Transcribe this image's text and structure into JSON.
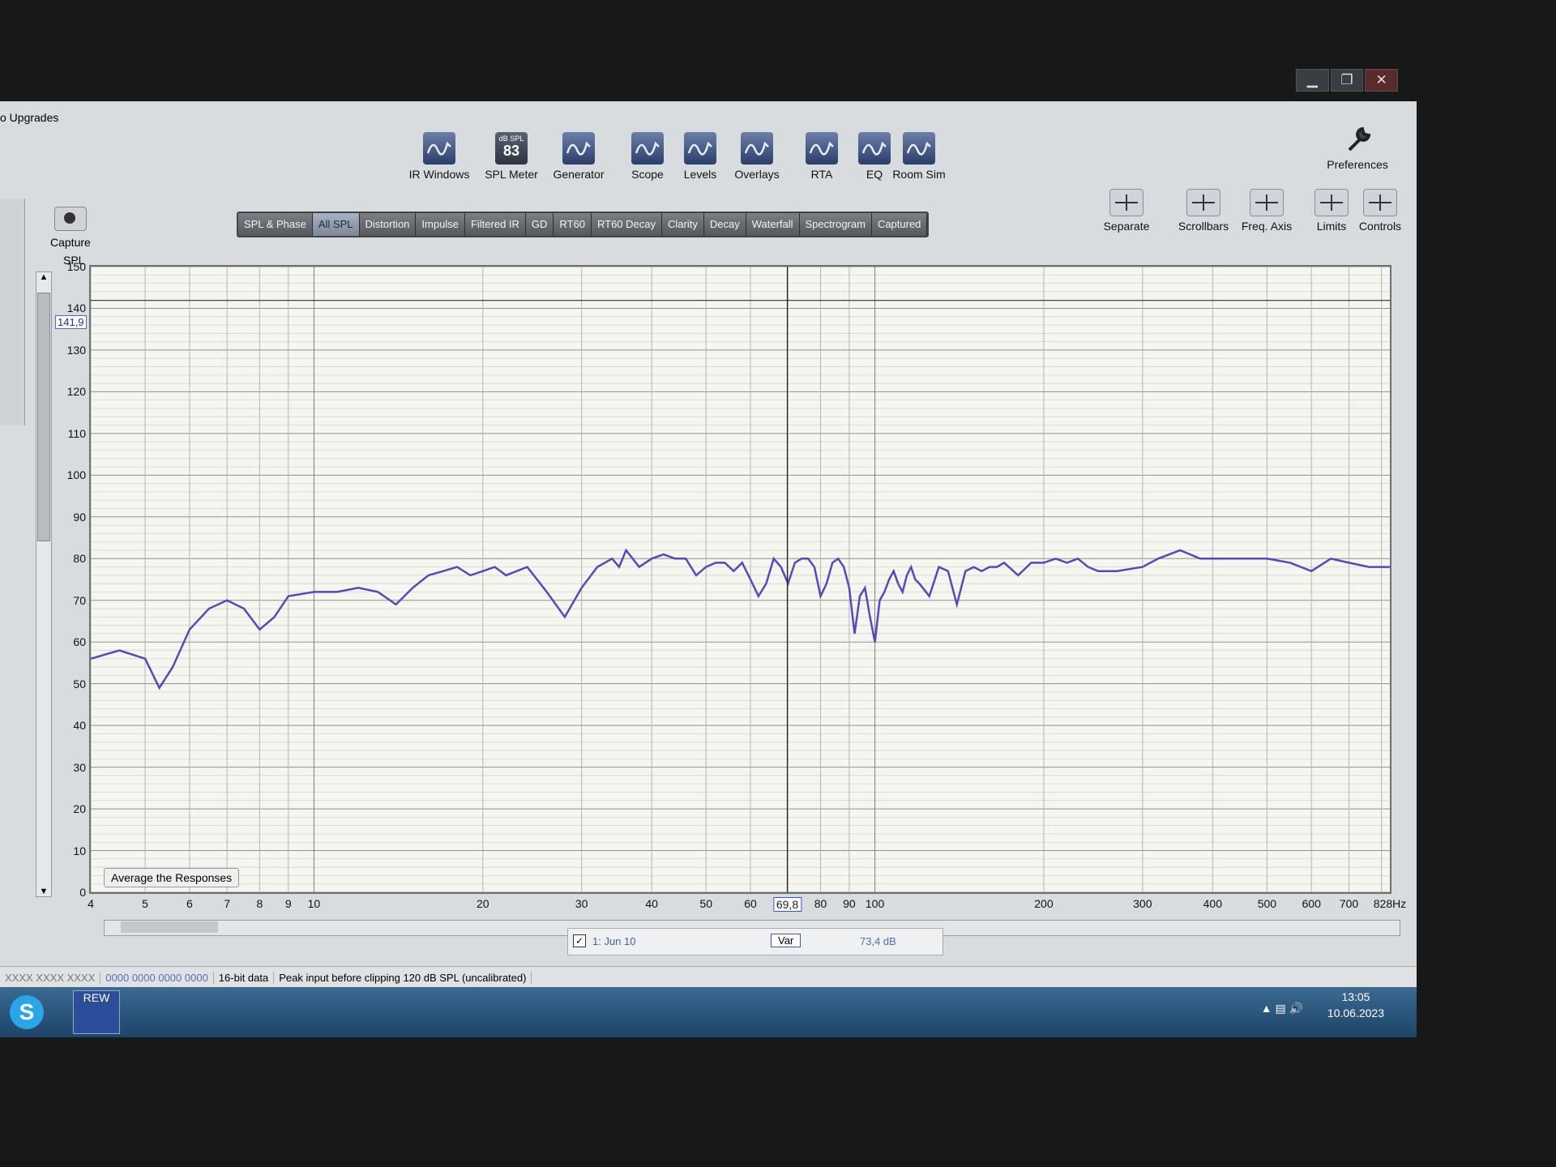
{
  "window": {
    "title": "o Upgrades",
    "controls": [
      "minimize",
      "restore",
      "close"
    ]
  },
  "toolbar": [
    {
      "label": "IR Windows",
      "icon": "ir-windows-icon"
    },
    {
      "label": "SPL Meter",
      "icon": "spl-meter-icon",
      "meter_top": "dB SPL",
      "meter_value": "83"
    },
    {
      "label": "Generator",
      "icon": "generator-icon"
    },
    {
      "label": "Scope",
      "icon": "scope-icon"
    },
    {
      "label": "Levels",
      "icon": "levels-icon"
    },
    {
      "label": "Overlays",
      "icon": "overlays-icon"
    },
    {
      "label": "RTA",
      "icon": "rta-icon"
    },
    {
      "label": "EQ",
      "icon": "eq-icon"
    },
    {
      "label": "Room Sim",
      "icon": "room-sim-icon"
    }
  ],
  "preferences": {
    "label": "Preferences",
    "icon": "wrench-icon"
  },
  "graph_controls": [
    {
      "label": "Separate",
      "icon": "separate-icon"
    },
    {
      "label": "Scrollbars",
      "icon": "scrollbars-icon"
    },
    {
      "label": "Freq. Axis",
      "icon": "freq-axis-icon"
    },
    {
      "label": "Limits",
      "icon": "limits-icon"
    },
    {
      "label": "Controls",
      "icon": "controls-icon"
    }
  ],
  "capture": {
    "label": "Capture",
    "icon": "camera-icon"
  },
  "tabs": [
    "SPL & Phase",
    "All SPL",
    "Distortion",
    "Impulse",
    "Filtered IR",
    "GD",
    "RT60",
    "RT60 Decay",
    "Clarity",
    "Decay",
    "Waterfall",
    "Spectrogram",
    "Captured"
  ],
  "active_tab": "All SPL",
  "y_axis_label": "SPL",
  "y_cursor_value": "141,9",
  "x_cursor_value": "69,8",
  "average_button": "Average the Responses",
  "legend": {
    "checked": true,
    "name": "1: Jun 10",
    "var_label": "Var",
    "level": "73,4 dB"
  },
  "status": [
    "XXXX XXXX XXXX",
    "0000 0000 0000 0000",
    "16-bit data",
    "Peak input before clipping 120 dB SPL (uncalibrated)"
  ],
  "clock": {
    "time": "13:05",
    "date": "10.06.2023"
  },
  "taskbar_apps": [
    {
      "name": "skype-icon",
      "label": ""
    },
    {
      "name": "rew-app-icon",
      "label": "REW"
    }
  ],
  "colors": {
    "trace": "#5a47b8",
    "plot_bg": "#f6f6f0",
    "grid": "#aeb0ae"
  },
  "chart_data": {
    "type": "line",
    "scale": "log-x",
    "ylabel": "SPL",
    "xlim": [
      4,
      828
    ],
    "ylim": [
      0,
      150
    ],
    "y_ticks": [
      150,
      140,
      130,
      120,
      110,
      100,
      90,
      80,
      70,
      60,
      50,
      40,
      30,
      20,
      10,
      0
    ],
    "x_tick_labels": [
      "4",
      "5",
      "6",
      "7",
      "8",
      "9",
      "10",
      "20",
      "30",
      "40",
      "50",
      "60",
      "80",
      "90",
      "100",
      "200",
      "300",
      "400",
      "500",
      "600",
      "700",
      "828Hz"
    ],
    "series": [
      {
        "x": [
          4,
          4.5,
          5,
          5.3,
          5.6,
          6,
          6.5,
          7,
          7.5,
          8,
          8.5,
          9,
          10,
          11,
          12,
          13,
          14,
          15,
          16,
          17,
          18,
          19,
          20,
          21,
          22,
          24,
          26,
          28,
          30,
          32,
          34,
          35,
          36,
          37,
          38,
          40,
          42,
          44,
          46,
          48,
          50,
          52,
          54,
          56,
          58,
          60,
          62,
          64,
          66,
          68,
          70,
          72,
          74,
          76,
          78,
          80,
          82,
          84,
          86,
          88,
          90,
          92,
          94,
          96,
          98,
          100,
          102,
          104,
          106,
          108,
          110,
          112,
          114,
          116,
          118,
          120,
          125,
          130,
          135,
          140,
          145,
          150,
          155,
          160,
          165,
          170,
          180,
          190,
          200,
          210,
          220,
          230,
          240,
          250,
          270,
          300,
          320,
          350,
          380,
          400,
          450,
          500,
          550,
          600,
          650,
          700,
          760,
          828
        ],
        "y": [
          56,
          58,
          56,
          49,
          54,
          63,
          68,
          70,
          68,
          63,
          66,
          71,
          72,
          72,
          73,
          72,
          69,
          73,
          76,
          77,
          78,
          76,
          77,
          78,
          76,
          78,
          72,
          66,
          73,
          78,
          80,
          78,
          82,
          80,
          78,
          80,
          81,
          80,
          80,
          76,
          78,
          79,
          79,
          77,
          79,
          75,
          71,
          74,
          80,
          78,
          74,
          79,
          80,
          80,
          78,
          71,
          74,
          79,
          80,
          78,
          73,
          62,
          71,
          73,
          66,
          60,
          70,
          72,
          75,
          77,
          74,
          72,
          76,
          78,
          75,
          74,
          71,
          78,
          77,
          69,
          77,
          78,
          77,
          78,
          78,
          79,
          76,
          79,
          79,
          80,
          79,
          80,
          78,
          77,
          77,
          78,
          80,
          82,
          80,
          80,
          80,
          80,
          79,
          77,
          80,
          79,
          78,
          78
        ]
      }
    ]
  }
}
